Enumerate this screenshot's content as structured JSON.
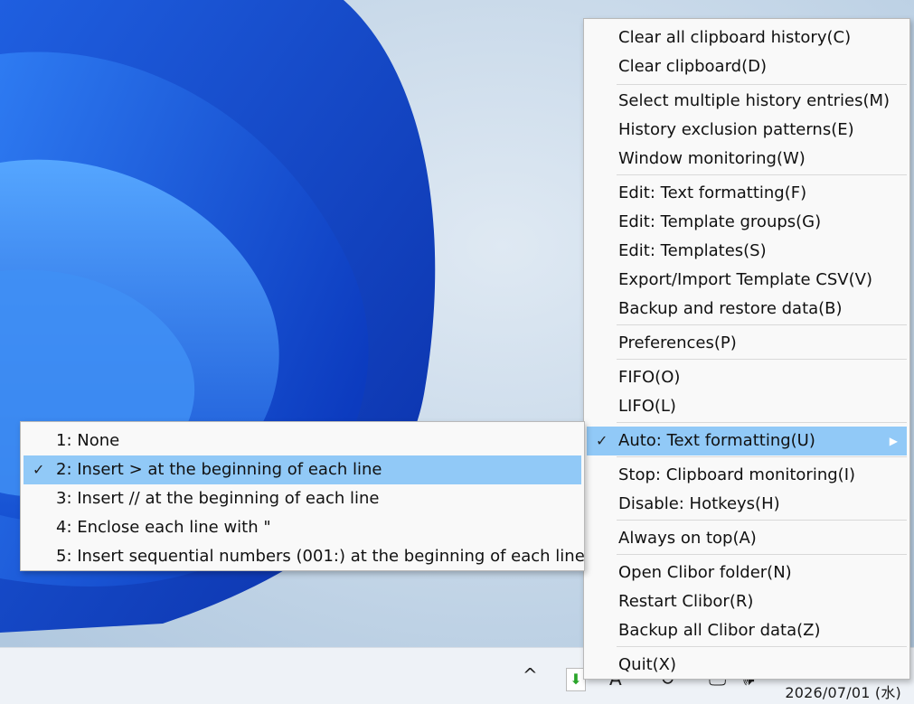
{
  "main_menu": {
    "items": [
      {
        "label": "Clear all clipboard history(C)"
      },
      {
        "label": "Clear clipboard(D)"
      },
      {
        "label": "Select multiple history entries(M)"
      },
      {
        "label": "History exclusion patterns(E)"
      },
      {
        "label": "Window monitoring(W)"
      },
      {
        "label": "Edit: Text formatting(F)"
      },
      {
        "label": "Edit: Template groups(G)"
      },
      {
        "label": "Edit: Templates(S)"
      },
      {
        "label": "Export/Import Template CSV(V)"
      },
      {
        "label": "Backup and restore data(B)"
      },
      {
        "label": "Preferences(P)"
      },
      {
        "label": "FIFO(O)"
      },
      {
        "label": "LIFO(L)"
      },
      {
        "label": "Auto: Text formatting(U)",
        "checked": true,
        "submenu": true
      },
      {
        "label": "Stop: Clipboard monitoring(I)"
      },
      {
        "label": "Disable: Hotkeys(H)"
      },
      {
        "label": "Always on top(A)"
      },
      {
        "label": "Open Clibor folder(N)"
      },
      {
        "label": "Restart Clibor(R)"
      },
      {
        "label": "Backup all Clibor data(Z)"
      },
      {
        "label": "Quit(X)"
      }
    ]
  },
  "sub_menu": {
    "items": [
      {
        "label": "1: None"
      },
      {
        "label": "2: Insert > at the beginning of each line",
        "checked": true
      },
      {
        "label": "3: Insert // at the beginning of each line"
      },
      {
        "label": "4: Enclose each line with \""
      },
      {
        "label": "5: Insert sequential numbers (001:) at the beginning of each line"
      }
    ]
  },
  "glyphs": {
    "check": "✓",
    "arrow": "▶",
    "tray_chevron": "^",
    "tray_app": "⬇",
    "tray_ime": "A",
    "tray_sync": "↻",
    "tray_network": "🖵",
    "tray_volume": "🕪"
  },
  "taskbar": {
    "clock": "2026/07/01 (水)"
  },
  "colors": {
    "highlight": "#91c9f7",
    "menu_bg": "#f9f9f9",
    "app_icon": "#2aa52a"
  }
}
